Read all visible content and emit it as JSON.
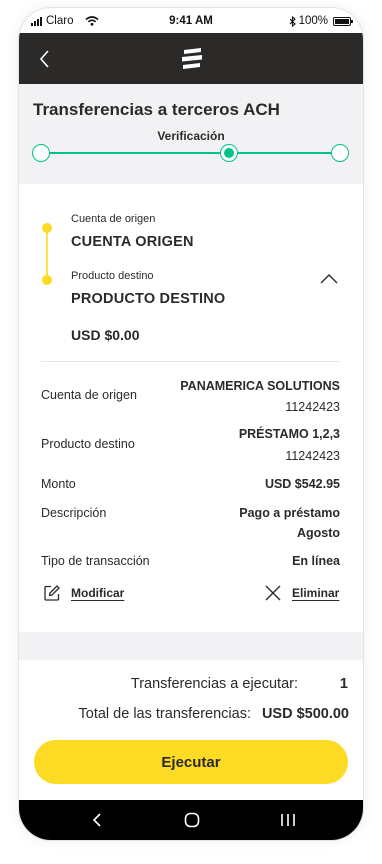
{
  "status_bar": {
    "carrier": "Claro",
    "time": "9:41 AM",
    "battery": "100%"
  },
  "header": {
    "title": "Transferencias a terceros ACH"
  },
  "stepper": {
    "current_step_label": "Verificación",
    "total_steps": 3,
    "current_step": 2
  },
  "transfer_card": {
    "origin_label": "Cuenta de origen",
    "origin_value": "CUENTA ORIGEN",
    "destination_label": "Producto destino",
    "destination_value": "PRODUCTO DESTINO",
    "amount": "USD $0.00"
  },
  "details": [
    {
      "label": "Cuenta de origen",
      "value": "PANAMERICA SOLUTIONS",
      "sub": "11242423"
    },
    {
      "label": "Producto destino",
      "value": "PRÉSTAMO 1,2,3",
      "sub": "11242423"
    },
    {
      "label": "Monto",
      "value": "USD $542.95"
    },
    {
      "label": "Descripción",
      "value": "Pago a préstamo",
      "sub": "Agosto"
    },
    {
      "label": "Tipo de transacción",
      "value": "En línea"
    }
  ],
  "actions": {
    "modify_label": "Modificar",
    "delete_label": "Eliminar"
  },
  "summary": {
    "count_label": "Transferencias a ejecutar:",
    "count_value": "1",
    "total_label": "Total de las transferencias:",
    "total_value": "USD $500.00"
  },
  "execute_button": "Ejecutar",
  "colors": {
    "brand_yellow": "#fdda24",
    "accent_green": "#00c389",
    "header_dark": "#2c2a29"
  }
}
